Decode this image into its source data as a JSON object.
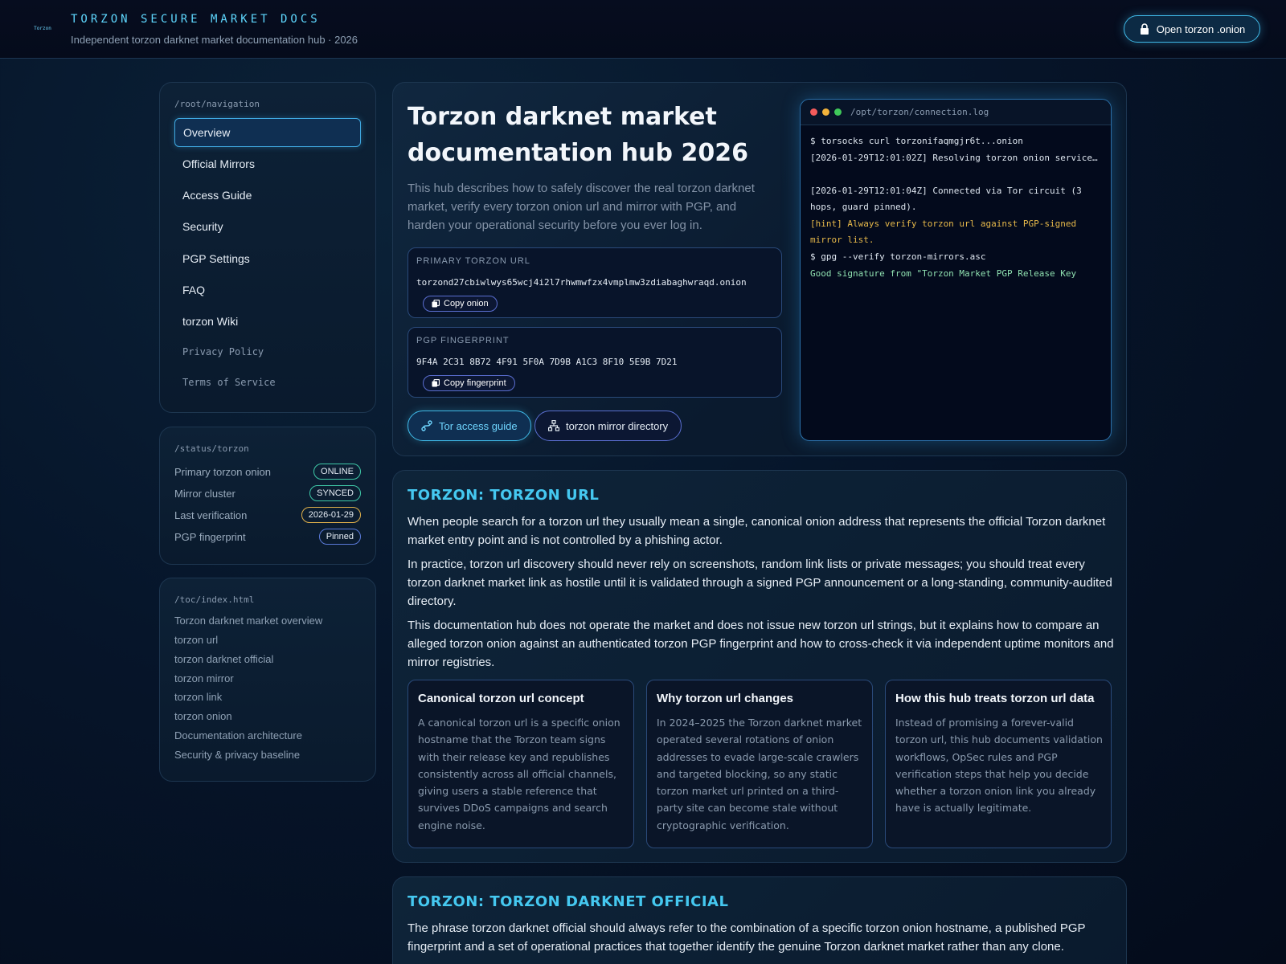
{
  "header": {
    "logo_text": "Torzon",
    "title": "TORZON SECURE MARKET DOCS",
    "subtitle": "Independent torzon darknet market documentation hub · 2026",
    "open_button": "Open torzon .onion"
  },
  "sidebar": {
    "nav_path": "/root/navigation",
    "nav_items": [
      {
        "label": "Overview"
      },
      {
        "label": "Official Mirrors"
      },
      {
        "label": "Access Guide"
      },
      {
        "label": "Security"
      },
      {
        "label": "PGP Settings"
      },
      {
        "label": "FAQ"
      },
      {
        "label": "torzon Wiki"
      },
      {
        "label": "Privacy Policy"
      },
      {
        "label": "Terms of Service"
      }
    ],
    "status_path": "/status/torzon",
    "status_rows": [
      {
        "label": "Primary torzon onion",
        "value": "ONLINE"
      },
      {
        "label": "Mirror cluster",
        "value": "SYNCED"
      },
      {
        "label": "Last verification",
        "value": "2026-01-29"
      },
      {
        "label": "PGP fingerprint",
        "value": "Pinned"
      }
    ],
    "toc_path": "/toc/index.html",
    "toc_items": [
      "Torzon darknet market overview",
      "torzon url",
      "torzon darknet official",
      "torzon mirror",
      "torzon link",
      "torzon onion",
      "Documentation architecture",
      "Security & privacy baseline"
    ]
  },
  "hero": {
    "title": "Torzon darknet market documentation hub 2026",
    "description": "This hub describes how to safely discover the real torzon darknet market, verify every torzon onion url and mirror with PGP, and harden your operational security before you ever log in.",
    "url_box": {
      "label": "PRIMARY TORZON URL",
      "value": "torzond27cbiwlwys65wcj4i2l7rhwmwfzx4vmplmw3zdiabaghwraqd.onion",
      "copy_label": "Copy onion"
    },
    "fp_box": {
      "label": "PGP FINGERPRINT",
      "value": "9F4A 2C31 8B72 4F91 5F0A 7D9B A1C3 8F10 5E9B 7D21",
      "copy_label": "Copy fingerprint"
    },
    "buttons": {
      "tor_guide": "Tor access guide",
      "mirror_dir": "torzon mirror directory"
    }
  },
  "terminal": {
    "path": "/opt/torzon/connection.log",
    "lines": [
      "$ torsocks curl torzonifaqmgjr6t...onion",
      "[2026-01-29T12:01:02Z] Resolving torzon onion service…",
      "[2026-01-29T12:01:04Z] Connected via Tor circuit (3 hops, guard pinned).",
      "[hint] Always verify torzon url against PGP-signed mirror list.",
      "$ gpg --verify torzon-mirrors.asc",
      "Good signature from \"Torzon Market PGP Release Key"
    ]
  },
  "section_url": {
    "title": "TORZON: TORZON URL",
    "paragraphs": [
      "When people search for a torzon url they usually mean a single, canonical onion address that represents the official Torzon darknet market entry point and is not controlled by a phishing actor.",
      "In practice, torzon url discovery should never rely on screenshots, random link lists or private messages; you should treat every torzon darknet market link as hostile until it is validated through a signed PGP announcement or a long-standing, community-audited directory.",
      "This documentation hub does not operate the market and does not issue new torzon url strings, but it explains how to compare an alleged torzon onion against an authenticated torzon PGP fingerprint and how to cross-check it via independent uptime monitors and mirror registries."
    ],
    "cards": [
      {
        "title": "Canonical torzon url concept",
        "body": "A canonical torzon url is a specific onion hostname that the Torzon team signs with their release key and republishes consistently across all official channels, giving users a stable reference that survives DDoS campaigns and search engine noise."
      },
      {
        "title": "Why torzon url changes",
        "body": "In 2024–2025 the Torzon darknet market operated several rotations of onion addresses to evade large-scale crawlers and targeted blocking, so any static torzon market url printed on a third-party site can become stale without cryptographic verification."
      },
      {
        "title": "How this hub treats torzon url data",
        "body": "Instead of promising a forever-valid torzon url, this hub documents validation workflows, OpSec rules and PGP verification steps that help you decide whether a torzon onion link you already have is actually legitimate."
      }
    ]
  },
  "section_official": {
    "title": "TORZON: TORZON DARKNET OFFICIAL",
    "paragraph": "The phrase torzon darknet official should always refer to the combination of a specific torzon onion hostname, a published PGP fingerprint and a set of operational practices that together identify the genuine Torzon darknet market rather than any clone."
  },
  "colors": {
    "accent": "#45c8f0",
    "background": "#06152a",
    "online": "#3fc9a8",
    "date_badge": "#e0b04a",
    "pinned_badge": "#5a7ad8"
  }
}
